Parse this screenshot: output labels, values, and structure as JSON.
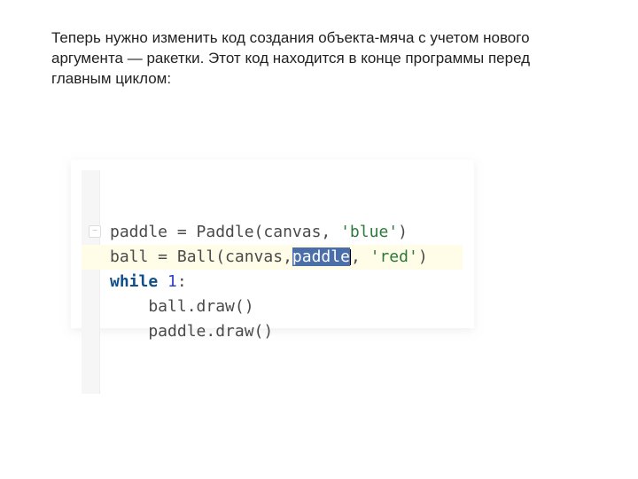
{
  "description": "Теперь нужно изменить код создания объекта-мяча с учетом нового аргумента — ракетки. Этот код находится в конце программы перед\nглавным циклом:",
  "code": {
    "line1": {
      "t1": "paddle = Paddle(canvas, ",
      "str": "'blue'",
      "t2": ")"
    },
    "line2": {
      "t1": "ball = Ball(canvas,",
      "sel": "paddle",
      "t2": ", ",
      "str": "'red'",
      "t3": ")"
    },
    "line3": {
      "kw": "while ",
      "num": "1",
      "t2": ":"
    },
    "line4": {
      "t1": "    ball.draw()"
    },
    "line5": {
      "t1": "    paddle.draw()"
    }
  }
}
